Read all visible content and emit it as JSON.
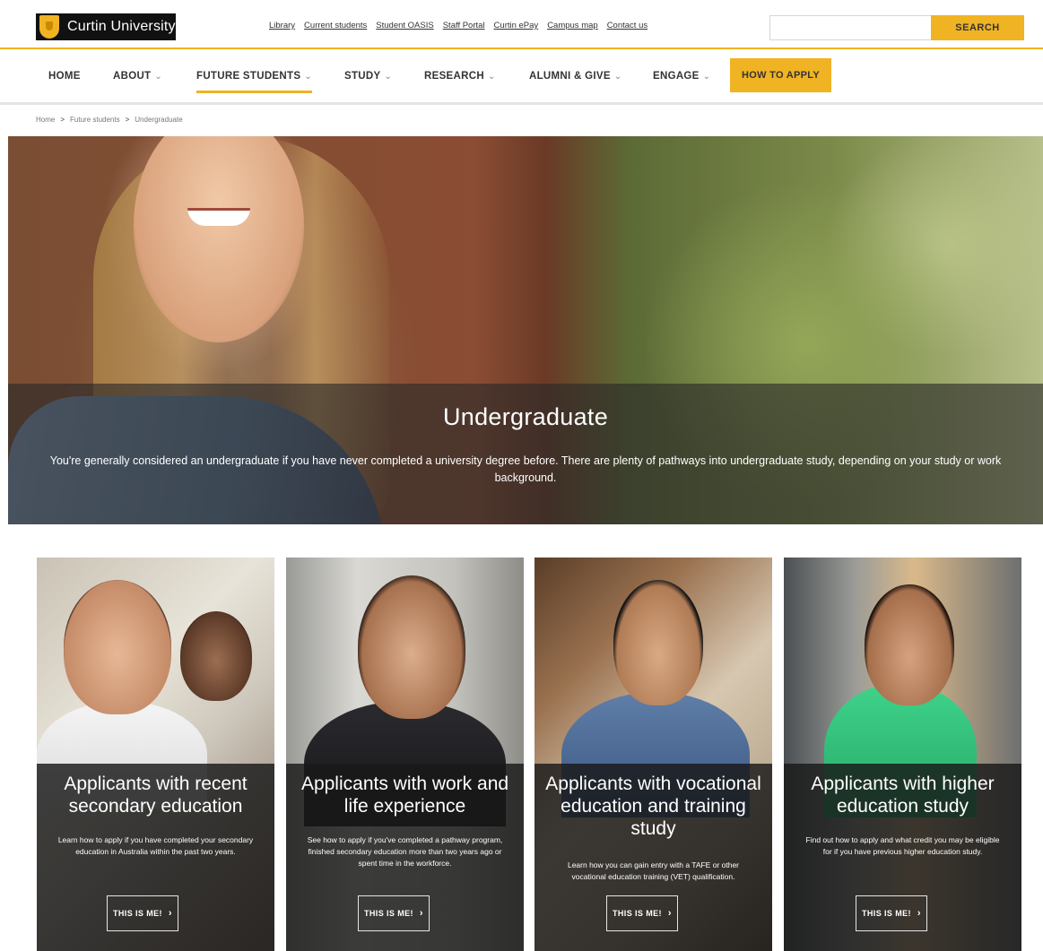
{
  "brand": {
    "name": "Curtin University"
  },
  "utility_links": [
    "Library",
    "Current students",
    "Student OASIS",
    "Staff Portal",
    "Curtin ePay",
    "Campus map",
    "Contact us"
  ],
  "search": {
    "placeholder": "",
    "button_label": "SEARCH"
  },
  "nav": {
    "items": [
      {
        "label": "HOME",
        "has_dropdown": false,
        "active": false
      },
      {
        "label": "ABOUT",
        "has_dropdown": true,
        "active": false
      },
      {
        "label": "FUTURE STUDENTS",
        "has_dropdown": true,
        "active": true
      },
      {
        "label": "STUDY",
        "has_dropdown": true,
        "active": false
      },
      {
        "label": "RESEARCH",
        "has_dropdown": true,
        "active": false
      },
      {
        "label": "ALUMNI & GIVE",
        "has_dropdown": true,
        "active": false
      },
      {
        "label": "ENGAGE",
        "has_dropdown": true,
        "active": false
      }
    ],
    "chevron": "⌄",
    "apply_label": "HOW TO APPLY"
  },
  "breadcrumb": {
    "items": [
      "Home",
      "Future students",
      "Undergraduate"
    ],
    "separator": ">"
  },
  "hero": {
    "title": "Undergraduate",
    "description": "You're generally considered an undergraduate if you have never completed a university degree before. There are plenty of pathways into undergraduate study, depending on your study or work background."
  },
  "cards": [
    {
      "title": "Applicants with recent secondary education",
      "description": "Learn how to apply if you have completed your secondary education in Australia within the past two years.",
      "button_label": "THIS IS ME!",
      "button_icon": "chevron-right-icon"
    },
    {
      "title": "Applicants with work and life experience",
      "description": "See how to apply if you've completed a pathway program, finished secondary education more than two years ago or spent time in the workforce.",
      "button_label": "THIS IS ME!",
      "button_icon": "chevron-right-icon"
    },
    {
      "title": "Applicants with vocational education and training study",
      "description": "Learn how you can gain entry with a TAFE or other vocational education training (VET) qualification.",
      "button_label": "THIS IS ME!",
      "button_icon": "chevron-right-icon"
    },
    {
      "title": "Applicants with higher education study",
      "description": "Find out how to apply and what credit you may be eligible for if you have previous higher education study.",
      "button_label": "THIS IS ME!",
      "button_icon": "chevron-right-icon"
    }
  ],
  "colors": {
    "accent": "#f0b323",
    "brand_dark": "#111111",
    "overlay": "#191919"
  }
}
